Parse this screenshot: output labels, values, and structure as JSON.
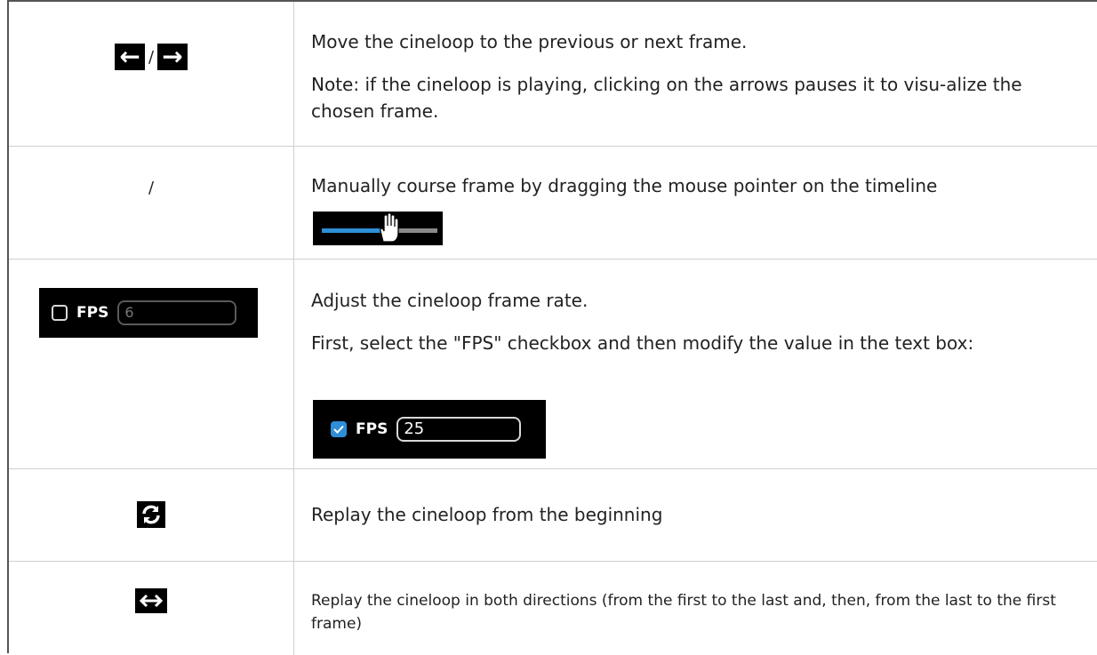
{
  "rows": [
    {
      "separator": "/",
      "description": "Move the cineloop to the previous or next frame.",
      "note": "Note: if the cineloop is playing, clicking on the arrows pauses it to visu-alize the chosen frame."
    },
    {
      "icon_text": "/",
      "description": "Manually course frame by dragging the mouse pointer on the timeline"
    },
    {
      "fps_label": "FPS",
      "fps_value_disabled": "6",
      "description": "Adjust the cineloop frame rate.",
      "instruction": "First, select the \"FPS\" checkbox and then modify the value in the text box:",
      "fps_label_enabled": "FPS",
      "fps_value_enabled": "25"
    },
    {
      "description": "Replay the cineloop from the beginning"
    },
    {
      "description": "Replay the cineloop in both directions (from the first to the last and, then, from the last to the first frame)"
    }
  ],
  "icons": {
    "prev": "arrow-left-icon",
    "next": "arrow-right-icon",
    "replay": "replay-icon",
    "bidirectional": "bidirectional-arrow-icon",
    "hand": "hand-pointer-icon"
  },
  "colors": {
    "accent": "#2e8fd6",
    "icon_background": "#000000"
  }
}
